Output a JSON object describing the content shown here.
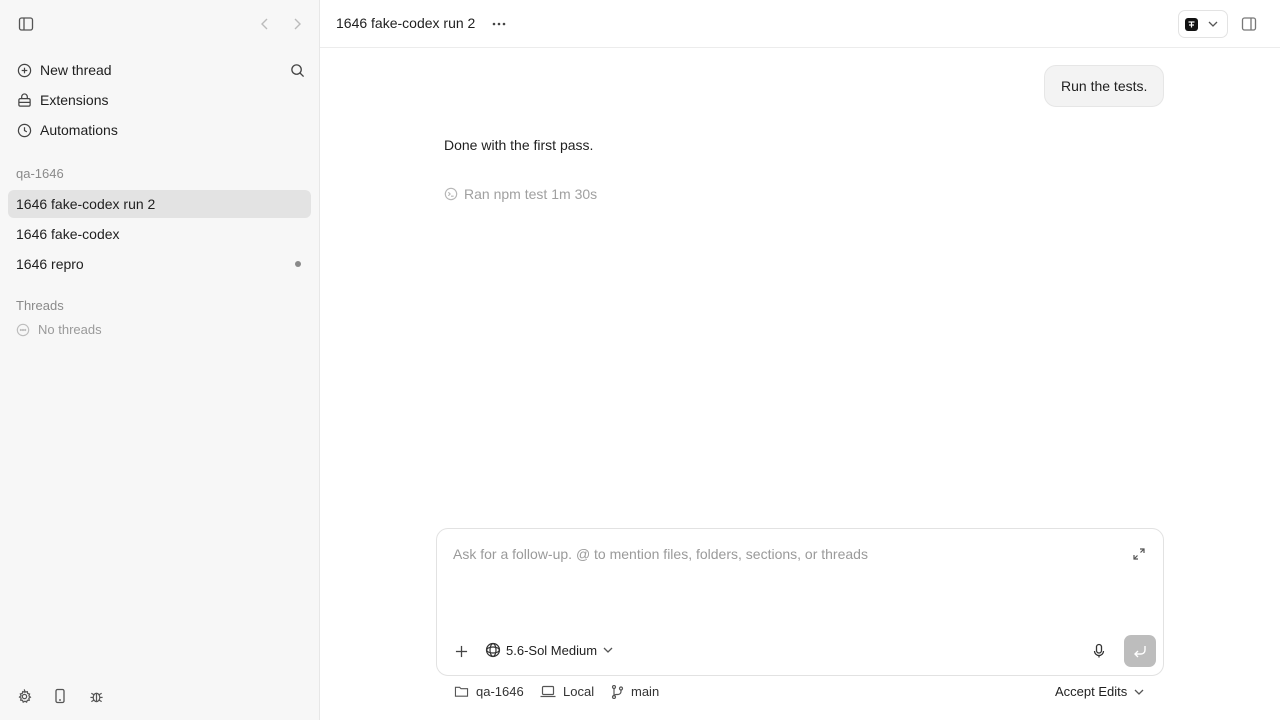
{
  "sidebar": {
    "nav": [
      {
        "label": "New thread",
        "icon": "plus-circle-icon"
      },
      {
        "label": "Extensions",
        "icon": "puzzle-icon"
      },
      {
        "label": "Automations",
        "icon": "clock-icon"
      }
    ],
    "project_label": "qa-1646",
    "project_threads": [
      {
        "label": "1646 fake-codex run 2",
        "active": true
      },
      {
        "label": "1646 fake-codex"
      },
      {
        "label": "1646 repro",
        "unread": true
      }
    ],
    "threads_label": "Threads",
    "empty_threads": "No threads"
  },
  "header": {
    "title": "1646 fake-codex run 2"
  },
  "conversation": {
    "user_message": "Run the tests.",
    "assistant_message": "Done with the first pass.",
    "tool_call": {
      "label": "Ran npm test",
      "duration": "1m 30s"
    }
  },
  "composer": {
    "placeholder": "Ask for a follow-up. @ to mention files, folders, sections, or threads",
    "model": "5.6-Sol Medium"
  },
  "statusbar": {
    "project": "qa-1646",
    "environment": "Local",
    "branch": "main",
    "accept_mode": "Accept Edits"
  },
  "colors": {
    "sidebar_bg": "#f7f7f7",
    "active_item_bg": "#e3e3e3",
    "send_button": "#bdbdbd"
  }
}
